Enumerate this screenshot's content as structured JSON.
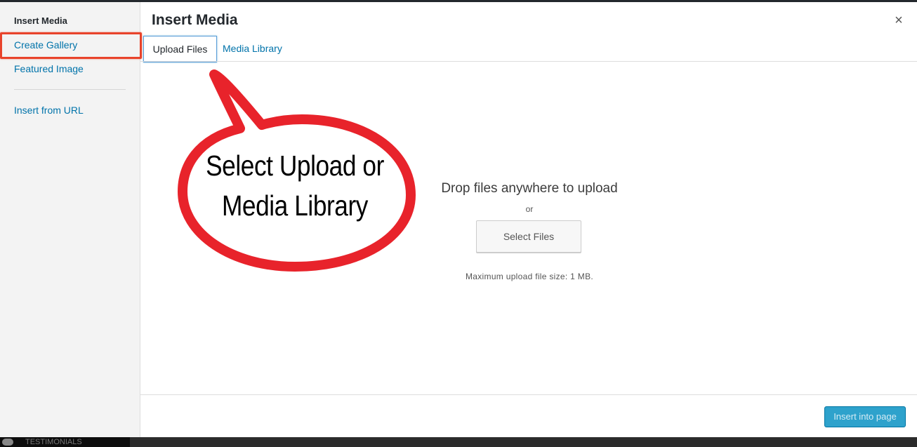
{
  "sidebar": {
    "heading": "Insert Media",
    "items": [
      {
        "label": "Create Gallery"
      },
      {
        "label": "Featured Image"
      },
      {
        "label": "Insert from URL"
      }
    ]
  },
  "header": {
    "title": "Insert Media",
    "close_icon": "×"
  },
  "tabs": [
    {
      "label": "Upload Files",
      "active": true
    },
    {
      "label": "Media Library",
      "active": false
    }
  ],
  "uploader": {
    "drop_text": "Drop files anywhere to upload",
    "or_text": "or",
    "select_button": "Select Files",
    "max_size_text": "Maximum upload file size: 1 MB."
  },
  "annotation": {
    "line1": "Select Upload or",
    "line2": "Media Library",
    "color": "#e8232b"
  },
  "footer": {
    "insert_button": "Insert into page"
  },
  "taskbar": {
    "label": "TESTIMONIALS"
  },
  "colors": {
    "link": "#0073aa",
    "primary_button": "#2ea2cc",
    "highlight": "#e8432b"
  }
}
